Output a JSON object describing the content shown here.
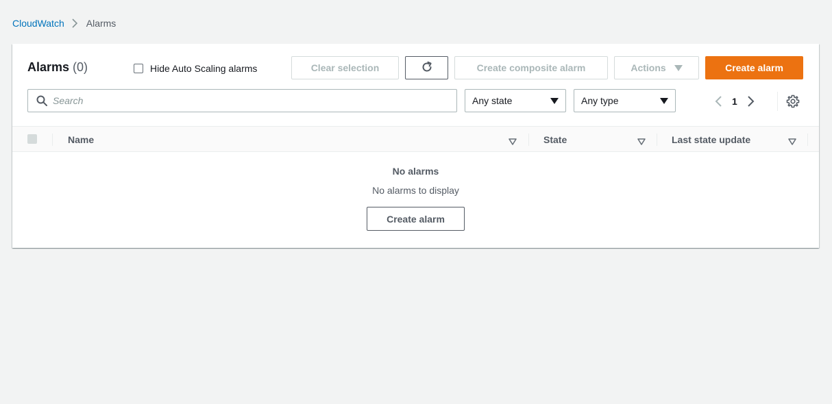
{
  "breadcrumb": {
    "root": "CloudWatch",
    "current": "Alarms"
  },
  "panel": {
    "title": "Alarms",
    "count": "(0)",
    "hide_autoscaling_label": "Hide Auto Scaling alarms",
    "hide_autoscaling_checked": false
  },
  "toolbar": {
    "clear_selection": "Clear selection",
    "create_composite": "Create composite alarm",
    "actions": "Actions",
    "create_alarm": "Create alarm"
  },
  "filters": {
    "search_placeholder": "Search",
    "state_value": "Any state",
    "type_value": "Any type"
  },
  "pagination": {
    "current_page": "1"
  },
  "table": {
    "columns": [
      "Name",
      "State",
      "Last state update"
    ]
  },
  "empty_state": {
    "title": "No alarms",
    "description": "No alarms to display",
    "button": "Create alarm"
  },
  "colors": {
    "primary": "#ec7211",
    "link": "#0073bb",
    "background": "#f2f3f3"
  }
}
